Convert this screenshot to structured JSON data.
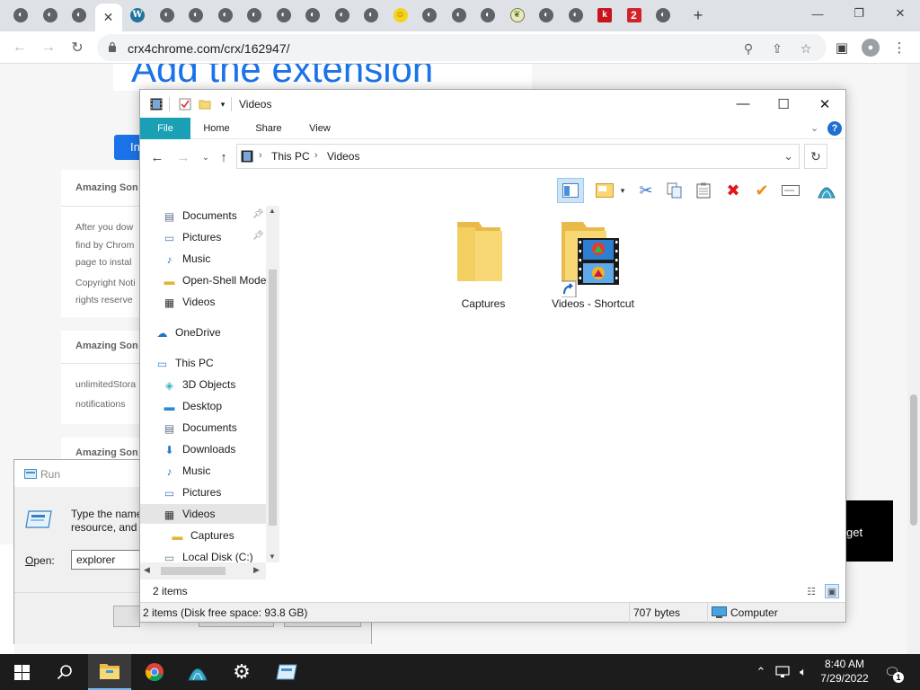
{
  "browser": {
    "url": "crx4chrome.com/crx/162947/",
    "tabs": [
      {
        "icon": "extension-tab-icon",
        "glyph": "◐"
      },
      {
        "icon": "extension-tab-icon",
        "glyph": "◐"
      },
      {
        "icon": "extension-tab-icon",
        "glyph": "◐"
      },
      {
        "icon": "close-tab-icon",
        "glyph": "✕",
        "active": true
      },
      {
        "icon": "wordpress-tab-icon",
        "glyph": "W"
      },
      {
        "icon": "extension-tab-icon",
        "glyph": "◐"
      },
      {
        "icon": "extension-tab-icon",
        "glyph": "◐"
      },
      {
        "icon": "extension-tab-icon",
        "glyph": "◐"
      },
      {
        "icon": "extension-tab-icon",
        "glyph": "◐"
      },
      {
        "icon": "extension-tab-icon",
        "glyph": "◐"
      },
      {
        "icon": "extension-tab-icon",
        "glyph": "◐"
      },
      {
        "icon": "extension-tab-icon",
        "glyph": "◐"
      },
      {
        "icon": "extension-tab-icon",
        "glyph": "◐"
      },
      {
        "icon": "smiley-tab-icon",
        "glyph": "☺"
      },
      {
        "icon": "extension-tab-icon",
        "glyph": "◐"
      },
      {
        "icon": "extension-tab-icon",
        "glyph": "◐"
      },
      {
        "icon": "extension-tab-icon",
        "glyph": "◐"
      },
      {
        "icon": "leaf-tab-icon",
        "glyph": "❦"
      },
      {
        "icon": "extension-tab-icon",
        "glyph": "◐"
      },
      {
        "icon": "extension-tab-icon",
        "glyph": "◐"
      },
      {
        "icon": "k-tab-icon",
        "glyph": "k"
      },
      {
        "icon": "two-tab-icon",
        "glyph": "2"
      },
      {
        "icon": "extension-tab-icon",
        "glyph": "◐"
      }
    ],
    "new_tab": "+",
    "page": {
      "banner": "Add the extension",
      "install_label": "In",
      "cards": [
        {
          "heading": "Amazing Son",
          "lines": [
            "After you dow",
            "find by Chrom",
            "page to instal",
            "Copyright Noti",
            "rights reserve"
          ]
        },
        {
          "heading": "Amazing Son",
          "lines": [
            "unlimitedStora",
            "notifications"
          ]
        },
        {
          "heading": "Amazing Son",
          "lines": []
        }
      ],
      "ad_text": "get"
    }
  },
  "run_dialog": {
    "title": "Run",
    "description_line1": "Type the name",
    "description_line2": "resource, and",
    "open_label_accel": "O",
    "open_label_rest": "pen:",
    "input_value": "explorer"
  },
  "explorer": {
    "title": "Videos",
    "ribbon_tabs": [
      "File",
      "Home",
      "Share",
      "View"
    ],
    "breadcrumb": [
      "This PC",
      "Videos"
    ],
    "nav_items": [
      {
        "label": "Documents",
        "icon": "documents-icon",
        "glyph": "▤",
        "indent": 1,
        "pinned": true
      },
      {
        "label": "Pictures",
        "icon": "pictures-icon",
        "glyph": "▭",
        "indent": 1,
        "pinned": true
      },
      {
        "label": "Music",
        "icon": "music-icon",
        "glyph": "♪",
        "indent": 1
      },
      {
        "label": "Open-Shell Mode",
        "icon": "folder-icon",
        "glyph": "▬",
        "indent": 1
      },
      {
        "label": "Videos",
        "icon": "videos-icon",
        "glyph": "▦",
        "indent": 1
      },
      {
        "label": "OneDrive",
        "icon": "onedrive-icon",
        "glyph": "☁",
        "indent": 0
      },
      {
        "label": "This PC",
        "icon": "this-pc-icon",
        "glyph": "▭",
        "indent": 0
      },
      {
        "label": "3D Objects",
        "icon": "3d-objects-icon",
        "glyph": "◈",
        "indent": 1
      },
      {
        "label": "Desktop",
        "icon": "desktop-icon",
        "glyph": "▬",
        "indent": 1
      },
      {
        "label": "Documents",
        "icon": "documents-icon",
        "glyph": "▤",
        "indent": 1
      },
      {
        "label": "Downloads",
        "icon": "downloads-icon",
        "glyph": "⬇",
        "indent": 1
      },
      {
        "label": "Music",
        "icon": "music-icon",
        "glyph": "♪",
        "indent": 1
      },
      {
        "label": "Pictures",
        "icon": "pictures-icon",
        "glyph": "▭",
        "indent": 1
      },
      {
        "label": "Videos",
        "icon": "videos-icon",
        "glyph": "▦",
        "indent": 1,
        "selected": true
      },
      {
        "label": "Captures",
        "icon": "folder-icon",
        "glyph": "▬",
        "indent": 2
      },
      {
        "label": "Local Disk (C:)",
        "icon": "local-disk-icon",
        "glyph": "▭",
        "indent": 1
      }
    ],
    "files": [
      {
        "label": "Captures",
        "type": "folder"
      },
      {
        "label": "Videos - Shortcut",
        "type": "shortcut"
      }
    ],
    "status_count": "2 items",
    "details": {
      "summary": "2 items (Disk free space: 93.8 GB)",
      "size": "707 bytes",
      "location": "Computer"
    }
  },
  "taskbar": {
    "time": "8:40 AM",
    "date": "7/29/2022",
    "notification_count": "1"
  },
  "colors": {
    "ribbon_file_tab": "#19a0b4",
    "chrome_blue": "#1a73e8",
    "taskbar": "#1c1c1c",
    "folder_yellow": "#f8d775"
  }
}
